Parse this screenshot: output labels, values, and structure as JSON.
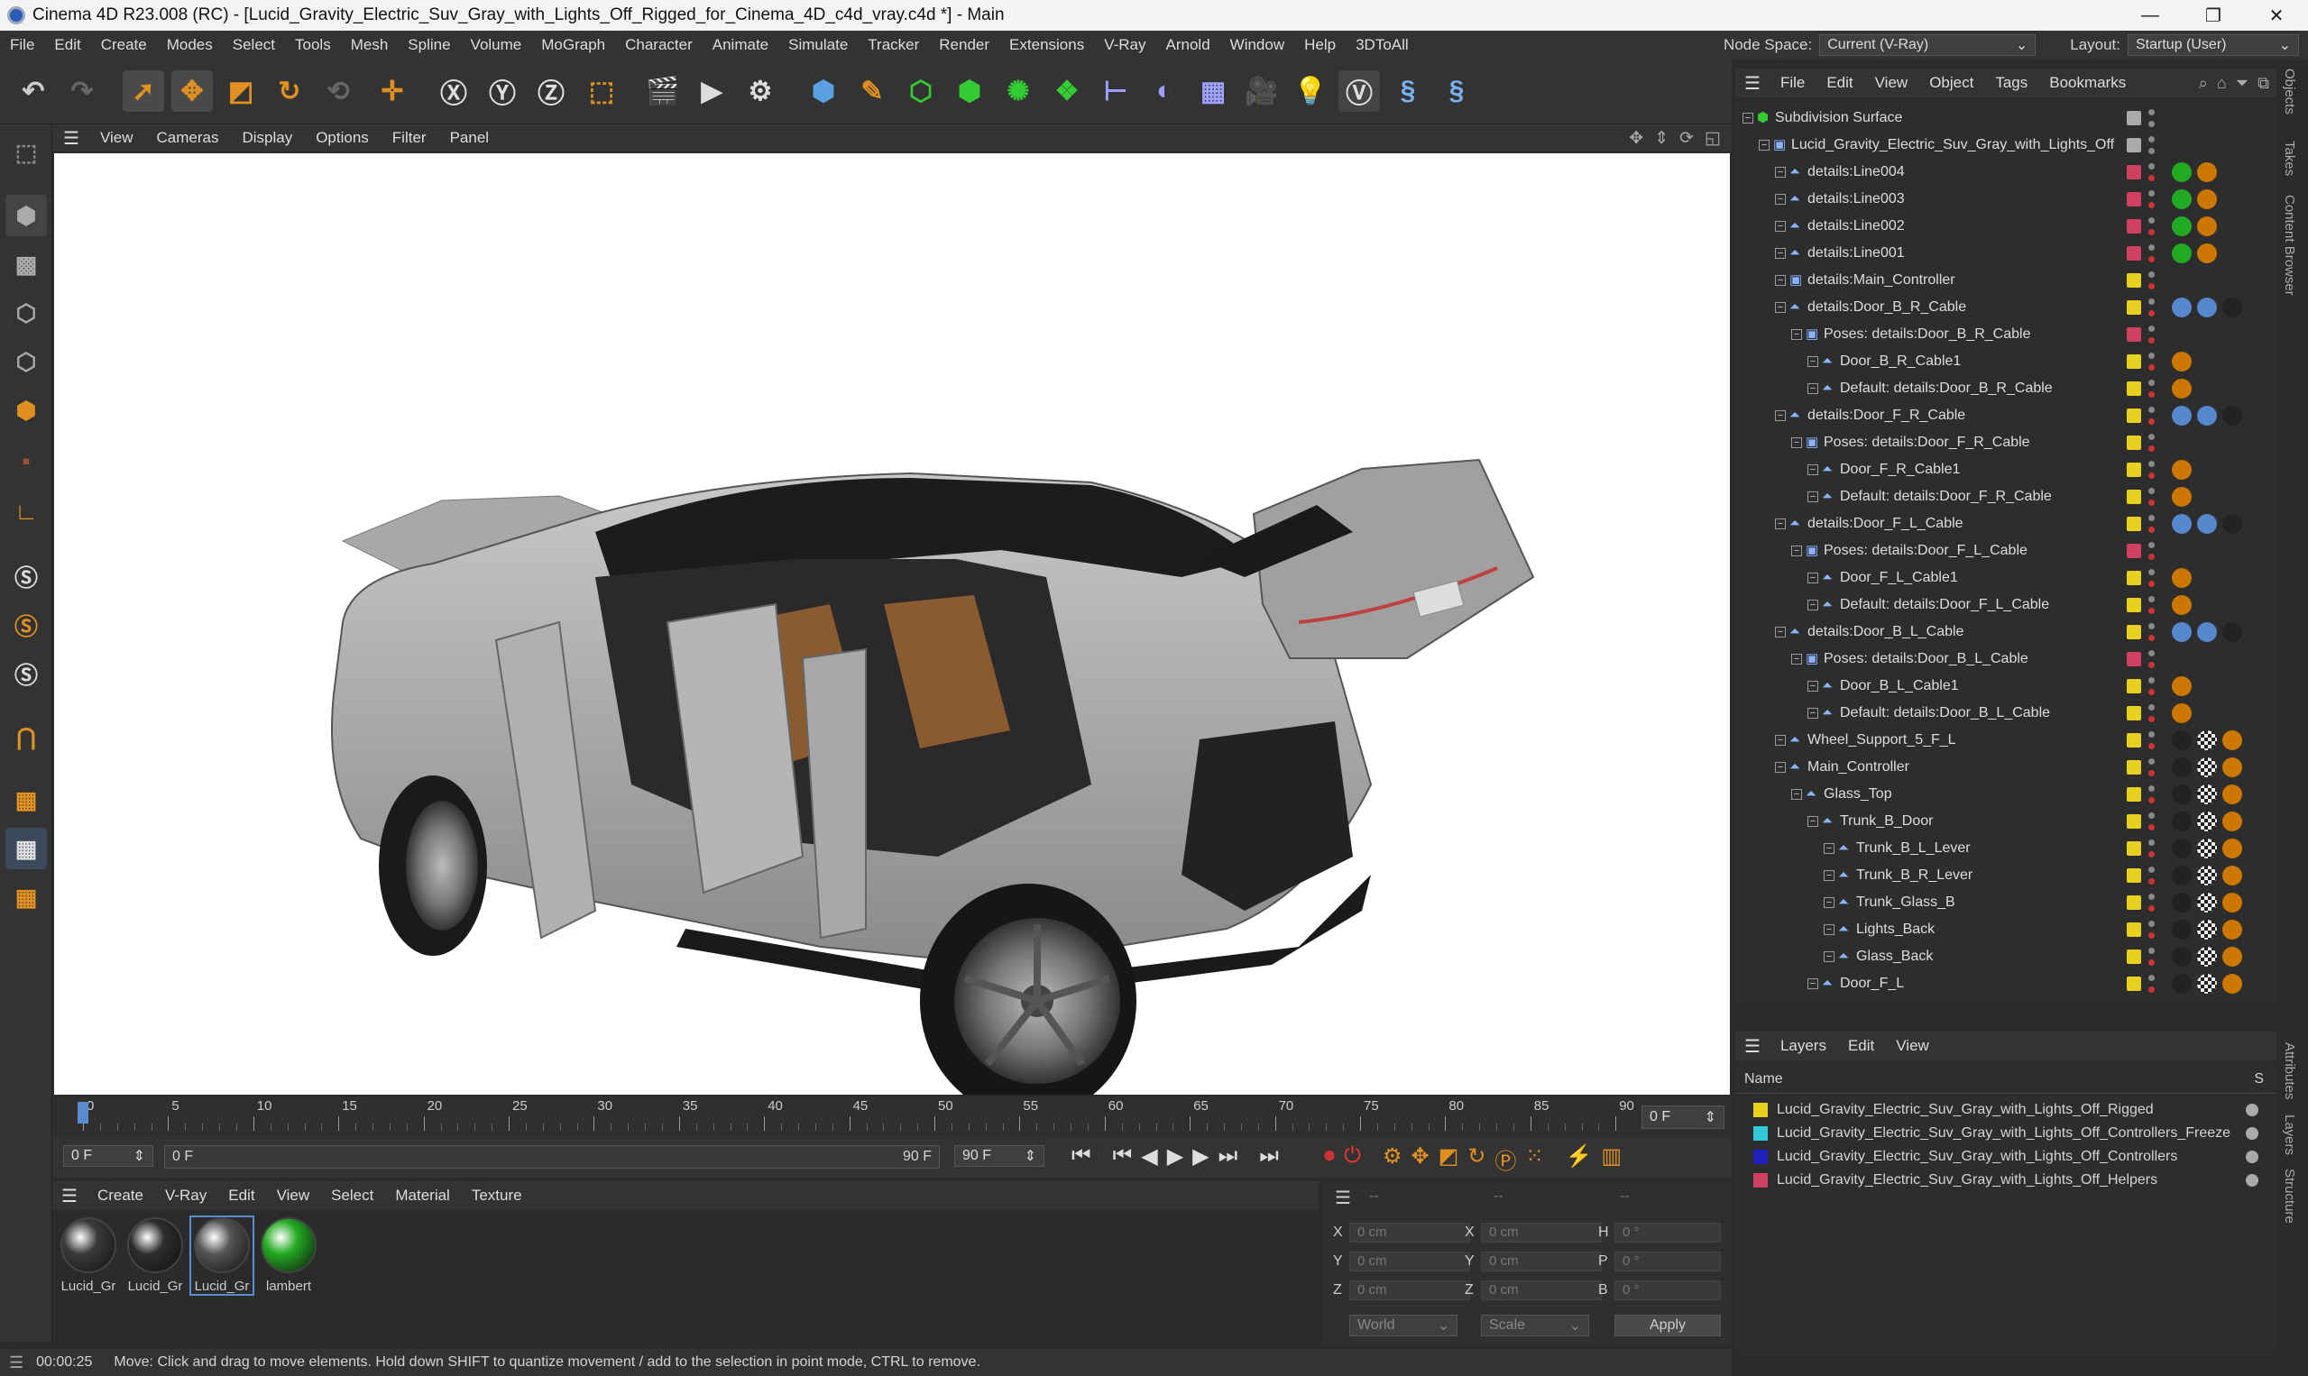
{
  "titlebar": {
    "title": "Cinema 4D R23.008 (RC) - [Lucid_Gravity_Electric_Suv_Gray_with_Lights_Off_Rigged_for_Cinema_4D_c4d_vray.c4d *] - Main",
    "minimize": "—",
    "maximize": "❐",
    "close": "✕"
  },
  "menubar": {
    "items": [
      "File",
      "Edit",
      "Create",
      "Modes",
      "Select",
      "Tools",
      "Mesh",
      "Spline",
      "Volume",
      "MoGraph",
      "Character",
      "Animate",
      "Simulate",
      "Tracker",
      "Render",
      "Extensions",
      "V-Ray",
      "Arnold",
      "Window",
      "Help",
      "3DToAll"
    ],
    "node_space_label": "Node Space:",
    "node_space_value": "Current (V-Ray)",
    "layout_label": "Layout:",
    "layout_value": "Startup (User)"
  },
  "viewport_menu": [
    "View",
    "Cameras",
    "Display",
    "Options",
    "Filter",
    "Panel"
  ],
  "timeline": {
    "ticks": [
      "0",
      "5",
      "10",
      "15",
      "20",
      "25",
      "30",
      "35",
      "40",
      "45",
      "50",
      "55",
      "60",
      "65",
      "70",
      "75",
      "80",
      "85",
      "90"
    ],
    "current_frame": "0 F",
    "start": "0 F",
    "range_start": "0 F",
    "range_end": "90 F",
    "end": "90 F"
  },
  "material_menu": [
    "Create",
    "V-Ray",
    "Edit",
    "View",
    "Select",
    "Material",
    "Texture"
  ],
  "materials": [
    {
      "label": "Lucid_Gr",
      "color": "#3a3a3a"
    },
    {
      "label": "Lucid_Gr",
      "color": "#2d2d2d"
    },
    {
      "label": "Lucid_Gr",
      "color": "#555555"
    },
    {
      "label": "lambert",
      "color": "#22aa22"
    }
  ],
  "coords": {
    "dash1": "--",
    "dash2": "--",
    "dash3": "--",
    "x_label": "X",
    "y_label": "Y",
    "z_label": "Z",
    "h_label": "H",
    "p_label": "P",
    "b_label": "B",
    "pos_x": "0 cm",
    "pos_y": "0 cm",
    "pos_z": "0 cm",
    "size_x": "0 cm",
    "size_y": "0 cm",
    "size_z": "0 cm",
    "rot_h": "0 °",
    "rot_p": "0 °",
    "rot_b": "0 °",
    "world": "World",
    "scale": "Scale",
    "apply": "Apply"
  },
  "status": {
    "time": "00:00:25",
    "message": "Move: Click and drag to move elements. Hold down SHIFT to quantize movement / add to the selection in point mode, CTRL to remove."
  },
  "object_manager_menu": [
    "File",
    "Edit",
    "View",
    "Object",
    "Tags",
    "Bookmarks"
  ],
  "objects": [
    {
      "name": "Subdivision Surface",
      "depth": 0,
      "color": "#aaaaaa",
      "icon": "subdivision-icon"
    },
    {
      "name": "Lucid_Gravity_Electric_Suv_Gray_with_Lights_Off",
      "depth": 1,
      "color": "#aaaaaa",
      "icon": "null-icon"
    },
    {
      "name": "details:Line004",
      "depth": 2,
      "color": "#d04060",
      "icon": "spline-icon"
    },
    {
      "name": "details:Line003",
      "depth": 2,
      "color": "#d04060",
      "icon": "spline-icon"
    },
    {
      "name": "details:Line002",
      "depth": 2,
      "color": "#d04060",
      "icon": "spline-icon"
    },
    {
      "name": "details:Line001",
      "depth": 2,
      "color": "#d04060",
      "icon": "spline-icon"
    },
    {
      "name": "details:Main_Controller",
      "depth": 2,
      "color": "#e8d020",
      "icon": "null-icon"
    },
    {
      "name": "details:Door_B_R_Cable",
      "depth": 2,
      "color": "#e8d020",
      "icon": "spline-icon"
    },
    {
      "name": "Poses: details:Door_B_R_Cable",
      "depth": 3,
      "color": "#d04060",
      "icon": "null-icon"
    },
    {
      "name": "Door_B_R_Cable1",
      "depth": 4,
      "color": "#e8d020",
      "icon": "spline-icon"
    },
    {
      "name": "Default: details:Door_B_R_Cable",
      "depth": 4,
      "color": "#e8d020",
      "icon": "spline-icon"
    },
    {
      "name": "details:Door_F_R_Cable",
      "depth": 2,
      "color": "#e8d020",
      "icon": "spline-icon"
    },
    {
      "name": "Poses: details:Door_F_R_Cable",
      "depth": 3,
      "color": "#e8d020",
      "icon": "null-icon"
    },
    {
      "name": "Door_F_R_Cable1",
      "depth": 4,
      "color": "#e8d020",
      "icon": "spline-icon"
    },
    {
      "name": "Default: details:Door_F_R_Cable",
      "depth": 4,
      "color": "#e8d020",
      "icon": "spline-icon"
    },
    {
      "name": "details:Door_F_L_Cable",
      "depth": 2,
      "color": "#e8d020",
      "icon": "spline-icon"
    },
    {
      "name": "Poses: details:Door_F_L_Cable",
      "depth": 3,
      "color": "#d04060",
      "icon": "null-icon"
    },
    {
      "name": "Door_F_L_Cable1",
      "depth": 4,
      "color": "#e8d020",
      "icon": "spline-icon"
    },
    {
      "name": "Default: details:Door_F_L_Cable",
      "depth": 4,
      "color": "#e8d020",
      "icon": "spline-icon"
    },
    {
      "name": "details:Door_B_L_Cable",
      "depth": 2,
      "color": "#e8d020",
      "icon": "spline-icon"
    },
    {
      "name": "Poses: details:Door_B_L_Cable",
      "depth": 3,
      "color": "#d04060",
      "icon": "null-icon"
    },
    {
      "name": "Door_B_L_Cable1",
      "depth": 4,
      "color": "#e8d020",
      "icon": "spline-icon"
    },
    {
      "name": "Default: details:Door_B_L_Cable",
      "depth": 4,
      "color": "#e8d020",
      "icon": "spline-icon"
    },
    {
      "name": "Wheel_Support_5_F_L",
      "depth": 2,
      "color": "#e8d020",
      "icon": "spline-icon"
    },
    {
      "name": "Main_Controller",
      "depth": 2,
      "color": "#e8d020",
      "icon": "spline-icon"
    },
    {
      "name": "Glass_Top",
      "depth": 3,
      "color": "#e8d020",
      "icon": "spline-icon"
    },
    {
      "name": "Trunk_B_Door",
      "depth": 4,
      "color": "#e8d020",
      "icon": "spline-icon"
    },
    {
      "name": "Trunk_B_L_Lever",
      "depth": 5,
      "color": "#e8d020",
      "icon": "spline-icon"
    },
    {
      "name": "Trunk_B_R_Lever",
      "depth": 5,
      "color": "#e8d020",
      "icon": "spline-icon"
    },
    {
      "name": "Trunk_Glass_B",
      "depth": 5,
      "color": "#e8d020",
      "icon": "spline-icon"
    },
    {
      "name": "Lights_Back",
      "depth": 5,
      "color": "#e8d020",
      "icon": "spline-icon"
    },
    {
      "name": "Glass_Back",
      "depth": 5,
      "color": "#e8d020",
      "icon": "spline-icon"
    },
    {
      "name": "Door_F_L",
      "depth": 4,
      "color": "#e8d020",
      "icon": "spline-icon"
    }
  ],
  "layers_menu": [
    "Layers",
    "Edit",
    "View"
  ],
  "layers_header": {
    "name": "Name",
    "s": "S"
  },
  "layers": [
    {
      "name": "Lucid_Gravity_Electric_Suv_Gray_with_Lights_Off_Rigged",
      "color": "#e8d020"
    },
    {
      "name": "Lucid_Gravity_Electric_Suv_Gray_with_Lights_Off_Controllers_Freeze",
      "color": "#30c8d8"
    },
    {
      "name": "Lucid_Gravity_Electric_Suv_Gray_with_Lights_Off_Controllers",
      "color": "#2020c0"
    },
    {
      "name": "Lucid_Gravity_Electric_Suv_Gray_with_Lights_Off_Helpers",
      "color": "#d04060"
    }
  ],
  "right_tabs": [
    "Objects",
    "Takes",
    "Content Browser",
    "Attributes",
    "Layers",
    "Structure"
  ]
}
